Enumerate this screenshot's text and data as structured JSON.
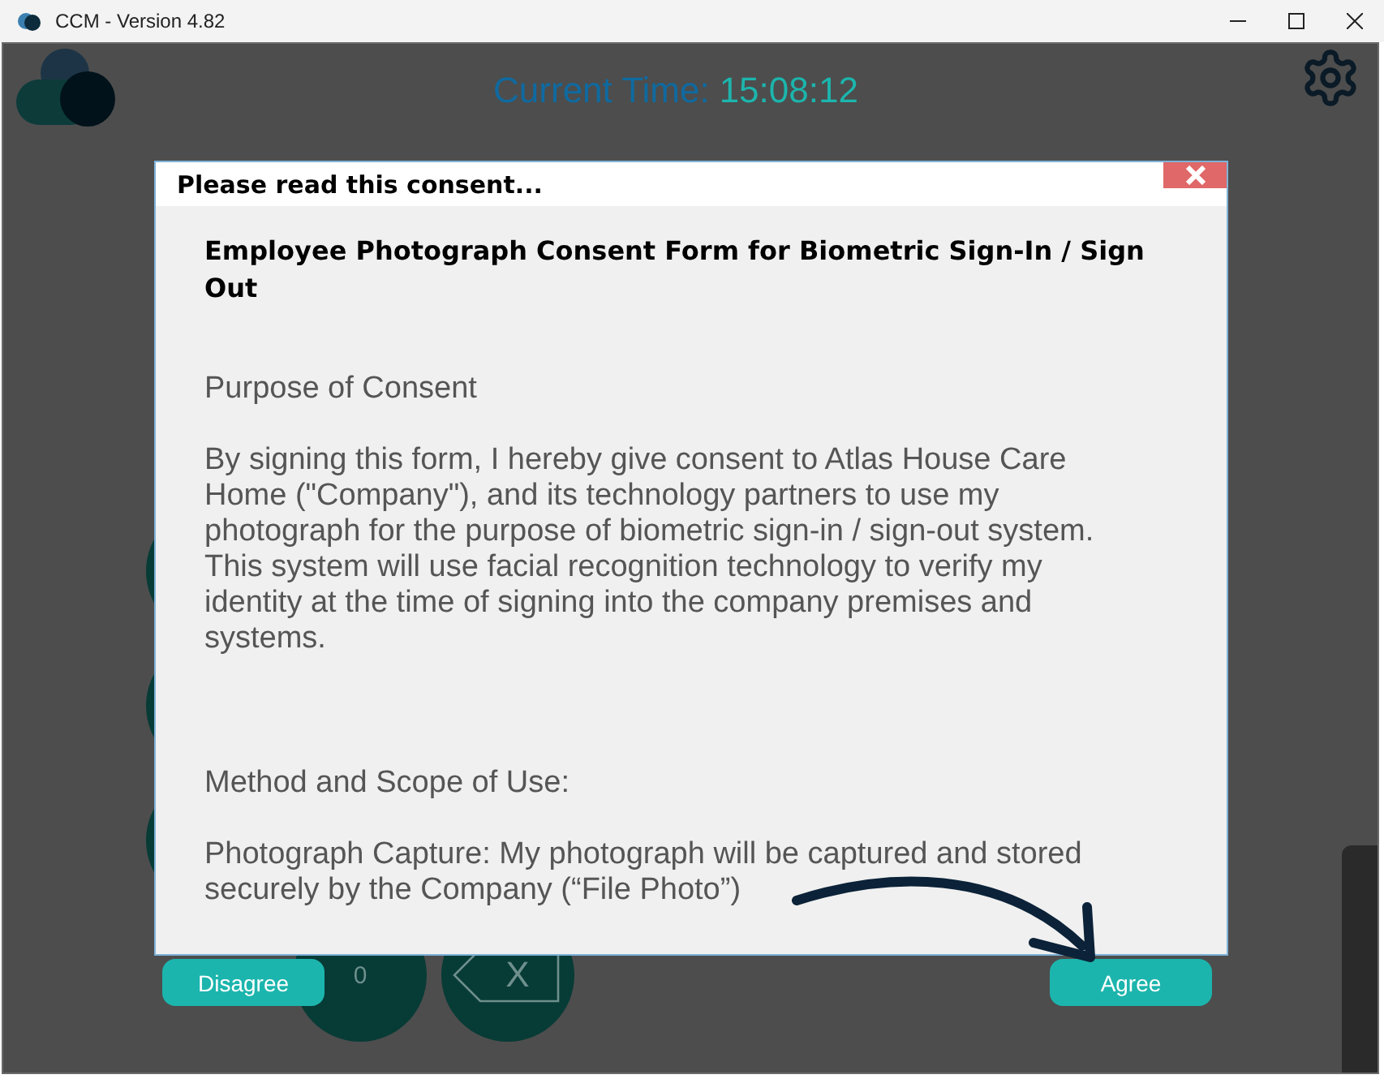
{
  "window": {
    "title": "CCM - Version 4.82"
  },
  "header": {
    "time_label": "Current Time:",
    "time_value": "15:08:12"
  },
  "keypad": [
    {
      "kind": "blank"
    },
    {
      "kind": "none"
    },
    {
      "kind": "none"
    },
    {
      "kind": "blank"
    },
    {
      "kind": "none"
    },
    {
      "kind": "none"
    },
    {
      "kind": "blank"
    },
    {
      "kind": "none"
    },
    {
      "kind": "none"
    },
    {
      "kind": "none"
    },
    {
      "kind": "digit",
      "label": "0"
    },
    {
      "kind": "backspace",
      "label": "X"
    }
  ],
  "dialog": {
    "title": "Please read this consent...",
    "heading": "Employee Photograph Consent Form for Biometric Sign-In / Sign Out",
    "paragraphs": [
      {
        "kind": "heading",
        "text": "Purpose of Consent"
      },
      {
        "kind": "text",
        "text": "By signing this form, I hereby give consent to Atlas House Care Home (\"Company\"), and its technology partners to use my photograph for the purpose of biometric sign-in / sign-out system. This system will use facial recognition technology to verify my identity at the time of signing into the company premises and systems."
      },
      {
        "kind": "heading",
        "text": "Method and Scope of Use:"
      },
      {
        "kind": "text",
        "text": "Photograph Capture: My photograph will be captured and stored securely by the Company (“File Photo”)"
      }
    ]
  },
  "buttons": {
    "disagree": "Disagree",
    "agree": "Agree"
  }
}
